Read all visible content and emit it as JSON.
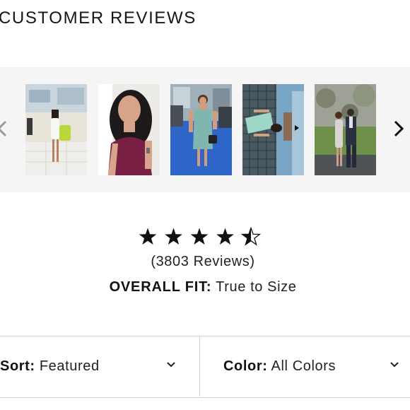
{
  "section": {
    "title": "CUSTOMER REVIEWS"
  },
  "carousel": {
    "prev_icon": "chevron-left-icon",
    "next_icon": "chevron-right-icon",
    "photos": [
      {
        "name": "customer-photo-1",
        "bg": "#c9d4dc",
        "accent": "#b8d83a"
      },
      {
        "name": "customer-photo-2",
        "bg": "#2b2326",
        "accent": "#7a1f44"
      },
      {
        "name": "customer-photo-3",
        "bg": "#2d66c8",
        "accent": "#7fb7b0"
      },
      {
        "name": "customer-photo-4",
        "bg": "#7aa6c6",
        "accent": "#9ed6c8"
      },
      {
        "name": "customer-photo-5",
        "bg": "#8a8f86",
        "accent": "#2b3040"
      }
    ]
  },
  "rating": {
    "stars": 4.5,
    "max_stars": 5,
    "review_count_text": "(3803 Reviews)",
    "fit_label": "OVERALL FIT:",
    "fit_value": "True to Size"
  },
  "filters": {
    "sort_label": "Sort:",
    "sort_value": "Featured",
    "color_label": "Color:",
    "color_value": "All Colors",
    "dropdown_icon": "chevron-down-icon"
  },
  "colors": {
    "text": "#111111",
    "carousel_bg": "#f5f5f5",
    "divider": "#d0d0d0"
  }
}
